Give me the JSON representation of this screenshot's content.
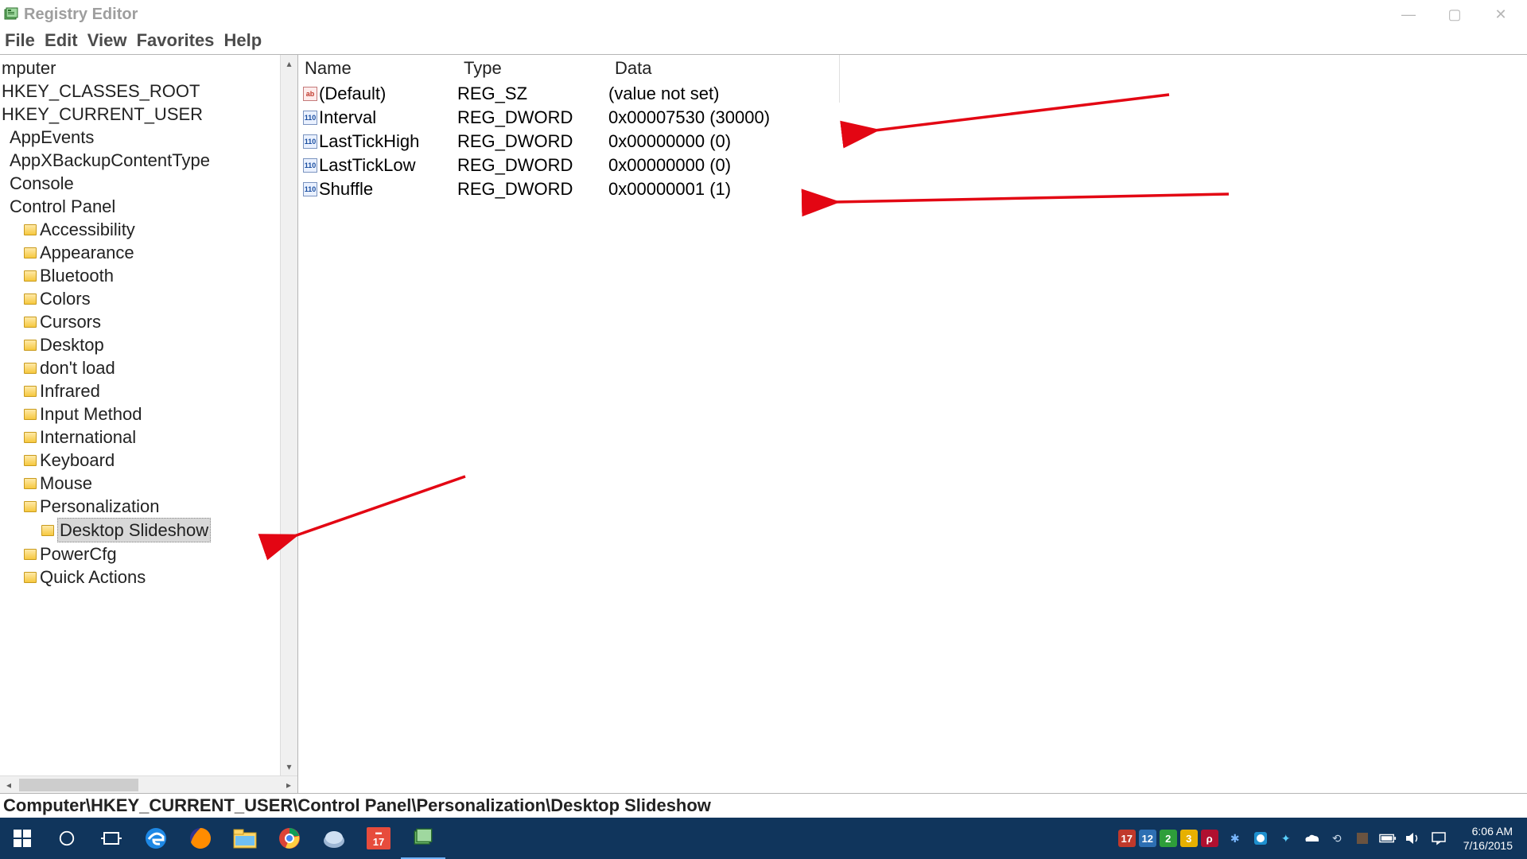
{
  "window": {
    "title": "Registry Editor"
  },
  "menu": {
    "file": "File",
    "edit": "Edit",
    "view": "View",
    "favorites": "Favorites",
    "help": "Help"
  },
  "tree": {
    "items": [
      {
        "label": "mputer",
        "level": 0,
        "folder": false
      },
      {
        "label": "HKEY_CLASSES_ROOT",
        "level": 1,
        "folder": false
      },
      {
        "label": "HKEY_CURRENT_USER",
        "level": 1,
        "folder": false
      },
      {
        "label": "AppEvents",
        "level": 2,
        "folder": false
      },
      {
        "label": "AppXBackupContentType",
        "level": 2,
        "folder": false
      },
      {
        "label": "Console",
        "level": 2,
        "folder": false
      },
      {
        "label": "Control Panel",
        "level": 2,
        "folder": false
      },
      {
        "label": "Accessibility",
        "level": 3,
        "folder": true
      },
      {
        "label": "Appearance",
        "level": 3,
        "folder": true
      },
      {
        "label": "Bluetooth",
        "level": 3,
        "folder": true
      },
      {
        "label": "Colors",
        "level": 3,
        "folder": true
      },
      {
        "label": "Cursors",
        "level": 3,
        "folder": true
      },
      {
        "label": "Desktop",
        "level": 3,
        "folder": true
      },
      {
        "label": "don't load",
        "level": 3,
        "folder": true
      },
      {
        "label": "Infrared",
        "level": 3,
        "folder": true
      },
      {
        "label": "Input Method",
        "level": 3,
        "folder": true
      },
      {
        "label": "International",
        "level": 3,
        "folder": true
      },
      {
        "label": "Keyboard",
        "level": 3,
        "folder": true
      },
      {
        "label": "Mouse",
        "level": 3,
        "folder": true
      },
      {
        "label": "Personalization",
        "level": 3,
        "folder": true
      },
      {
        "label": "Desktop Slideshow",
        "level": 4,
        "folder": true,
        "selected": true
      },
      {
        "label": "PowerCfg",
        "level": 3,
        "folder": true
      },
      {
        "label": "Quick Actions",
        "level": 3,
        "folder": true
      }
    ]
  },
  "list": {
    "headers": {
      "name": "Name",
      "type": "Type",
      "data": "Data"
    },
    "rows": [
      {
        "icon": "sz",
        "name": "(Default)",
        "type": "REG_SZ",
        "data": "(value not set)"
      },
      {
        "icon": "dw",
        "name": "Interval",
        "type": "REG_DWORD",
        "data": "0x00007530 (30000)"
      },
      {
        "icon": "dw",
        "name": "LastTickHigh",
        "type": "REG_DWORD",
        "data": "0x00000000 (0)"
      },
      {
        "icon": "dw",
        "name": "LastTickLow",
        "type": "REG_DWORD",
        "data": "0x00000000 (0)"
      },
      {
        "icon": "dw",
        "name": "Shuffle",
        "type": "REG_DWORD",
        "data": "0x00000001 (1)"
      }
    ]
  },
  "statusbar": {
    "path": "Computer\\HKEY_CURRENT_USER\\Control Panel\\Personalization\\Desktop Slideshow"
  },
  "tray": {
    "badges": [
      {
        "text": "17",
        "bg": "#c0392b"
      },
      {
        "text": "12",
        "bg": "#2d6fb3"
      },
      {
        "text": "2",
        "bg": "#2e9e3a"
      },
      {
        "text": "3",
        "bg": "#e6b000"
      },
      {
        "text": "ρ",
        "bg": "#b01030"
      }
    ],
    "time": "6:06 AM",
    "date": "7/16/2015"
  }
}
